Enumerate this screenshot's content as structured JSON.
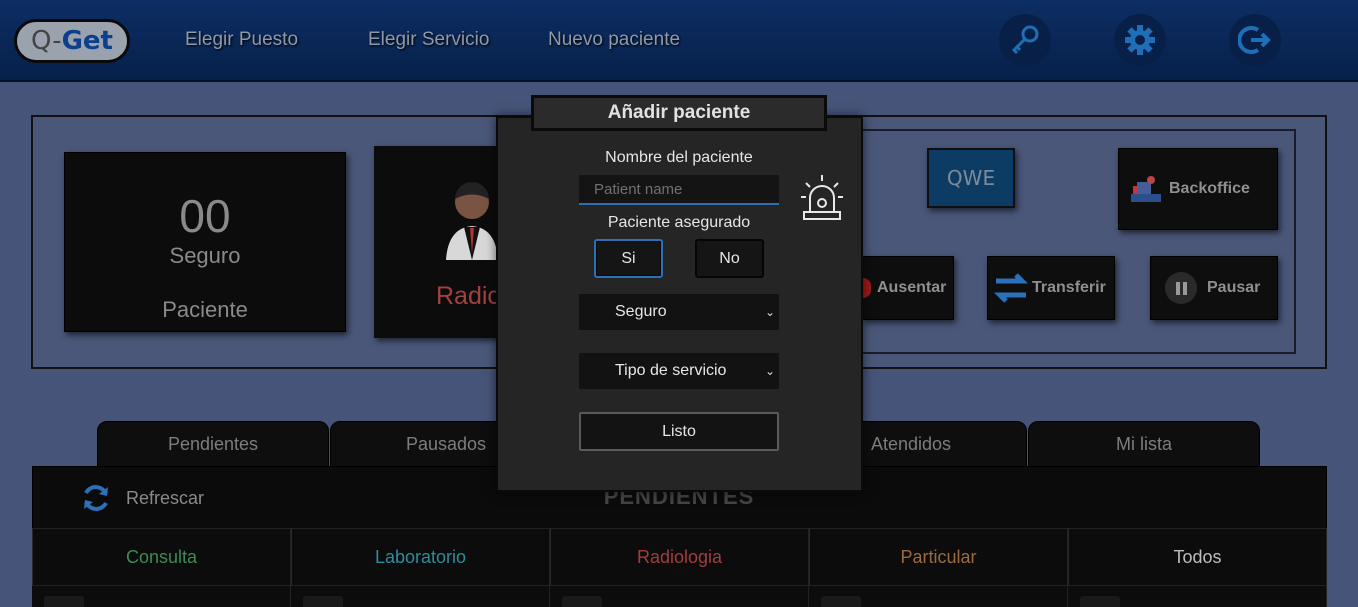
{
  "app": {
    "logo_prefix": "Q-",
    "logo_suffix": "Get",
    "nav": [
      "Elegir Puesto",
      "Elegir Servicio",
      "Nuevo paciente"
    ],
    "icons": [
      "key-icon",
      "gear-icon",
      "logout-icon"
    ]
  },
  "counter": {
    "number": "00",
    "type": "Seguro",
    "label": "Paciente"
  },
  "agent": {
    "label": "Radic"
  },
  "actions": {
    "qwe": "QWE",
    "backoffice": "Backoffice",
    "ausentar": "Ausentar",
    "transferir": "Transferir",
    "pausar": "Pausar"
  },
  "tabs": [
    "Pendientes",
    "Pausados",
    "Atendidos",
    "Mi lista"
  ],
  "list": {
    "refresh": "Refrescar",
    "title": "PENDIENTES",
    "categories": [
      {
        "label": "Consulta",
        "color": "#3e8a56"
      },
      {
        "label": "Laboratorio",
        "color": "#2d8c9e"
      },
      {
        "label": "Radiologia",
        "color": "#a23d3d"
      },
      {
        "label": "Particular",
        "color": "#9b6a3e"
      },
      {
        "label": "Todos",
        "color": "#bdbdbd"
      }
    ]
  },
  "modal": {
    "title": "Añadir paciente",
    "name_label": "Nombre del paciente",
    "name_placeholder": "Patient name",
    "insured_label": "Paciente asegurado",
    "yes": "Si",
    "no": "No",
    "insurance_select": "Seguro",
    "service_select": "Tipo de servicio",
    "submit": "Listo"
  },
  "colors": {
    "accent": "#2a71b9",
    "navbar": "#0d2e63",
    "background": "#465479"
  }
}
